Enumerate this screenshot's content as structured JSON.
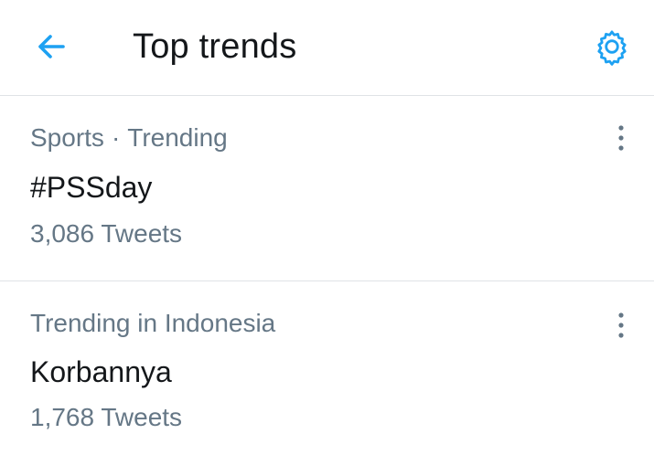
{
  "header": {
    "title": "Top trends",
    "back_icon": "arrow-left-icon",
    "settings_icon": "gear-icon"
  },
  "colors": {
    "accent": "#1da1f2",
    "primary_text": "#14171a",
    "secondary_text": "#657786",
    "divider": "#dfe3e6"
  },
  "trends": [
    {
      "category": "Sports",
      "separator": "·",
      "context_label": "Trending",
      "name": "#PSSday",
      "tweet_count": "3,086 Tweets",
      "more_icon": "more-vertical-icon"
    },
    {
      "context_label": "Trending in Indonesia",
      "name": "Korbannya",
      "tweet_count": "1,768 Tweets",
      "more_icon": "more-vertical-icon"
    }
  ]
}
